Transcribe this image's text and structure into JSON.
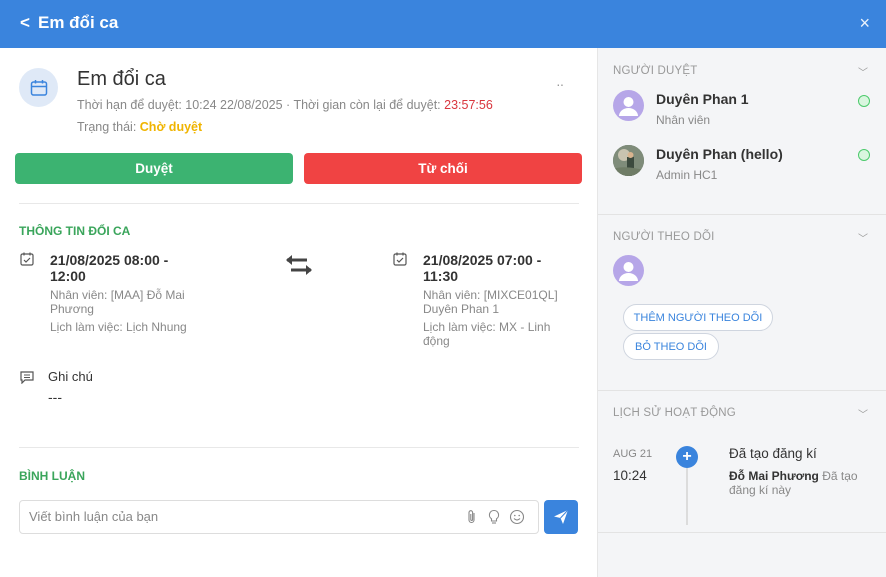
{
  "header": {
    "back_icon": "chevron-left-icon",
    "back": "<",
    "title": "Em đổi ca",
    "close": "×"
  },
  "request": {
    "title": "Em đổi ca",
    "deadline_label": "Thời hạn để duyệt: 10:24 22/08/2025 · Thời gian còn lại để duyệt:",
    "remaining": "23:57:56",
    "status_label": "Trạng thái:",
    "status_value": "Chờ duyệt",
    "more": "··",
    "colors": {
      "remaining": "#d9363e",
      "status": "#f0b400"
    }
  },
  "actions": {
    "approve": "Duyệt",
    "reject": "Từ chối",
    "colors": {
      "approve": "#3cb371",
      "reject": "#f04343"
    }
  },
  "shift_info": {
    "title": "THÔNG TIN ĐỔI CA",
    "from": {
      "time_line1": "21/08/2025 08:00 -",
      "time_line2": "12:00",
      "employee_line1": "Nhân viên: [MAA] Đỗ Mai",
      "employee_line2": "Phương",
      "schedule_line1": "Lịch làm việc: Lịch Nhung",
      "schedule_line2": ""
    },
    "to": {
      "time_line1": "21/08/2025 07:00 -",
      "time_line2": "11:30",
      "employee_line1": "Nhân viên: [MIXCE01QL]",
      "employee_line2": "Duyên Phan 1",
      "schedule_line1": "Lịch làm việc: MX - Linh",
      "schedule_line2": "động"
    }
  },
  "note": {
    "label": "Ghi chú",
    "value": "---"
  },
  "comments": {
    "title": "BÌNH LUẬN",
    "placeholder": "Viết bình luận của bạn"
  },
  "approvers": {
    "title": "NGƯỜI DUYỆT",
    "items": [
      {
        "name": "Duyên Phan 1",
        "role": "Nhân viên"
      },
      {
        "name": "Duyên Phan (hello)",
        "role": "Admin HC1"
      }
    ]
  },
  "followers": {
    "title": "NGƯỜI THEO DÕI",
    "add_button": "THÊM NGƯỜI THEO DÕI",
    "unfollow_button": "BỎ THEO DÕI"
  },
  "history": {
    "title": "LỊCH SỬ HOẠT ĐỘNG",
    "entries": [
      {
        "date": "AUG 21",
        "time": "10:24",
        "action": "Đã tạo đăng kí",
        "actor": "Đỗ Mai Phương",
        "detail": "Đã tạo đăng kí này"
      }
    ]
  }
}
